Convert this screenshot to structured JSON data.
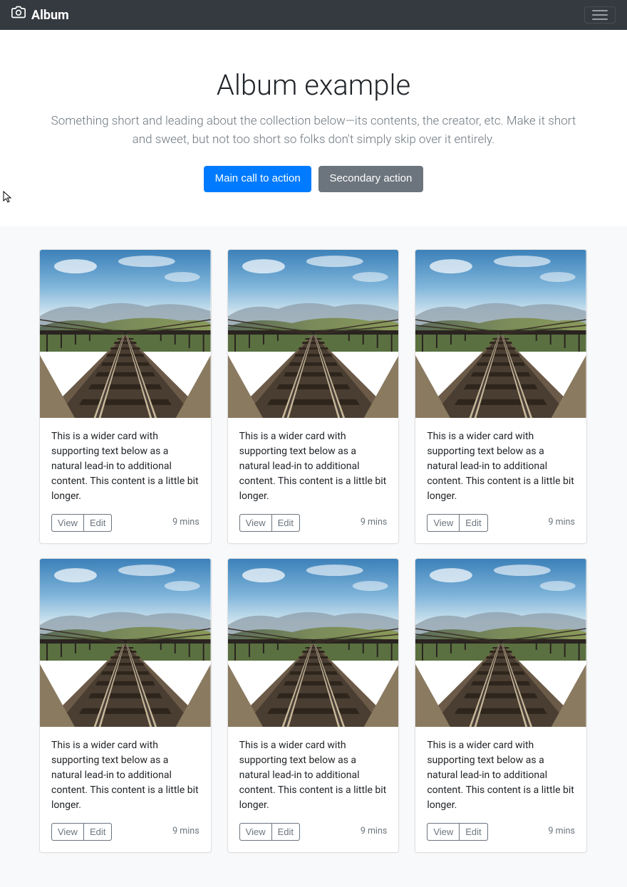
{
  "navbar": {
    "brand": "Album"
  },
  "hero": {
    "title": "Album example",
    "lead": "Something short and leading about the collection below—its contents, the creator, etc. Make it short and sweet, but not too short so folks don't simply skip over it entirely.",
    "primary_cta": "Main call to action",
    "secondary_cta": "Secondary action"
  },
  "card": {
    "text": "This is a wider card with supporting text below as a natural lead-in to additional content. This content is a little bit longer.",
    "view_label": "View",
    "edit_label": "Edit",
    "timestamp": "9 mins"
  },
  "cards": [
    0,
    1,
    2,
    3,
    4,
    5
  ]
}
